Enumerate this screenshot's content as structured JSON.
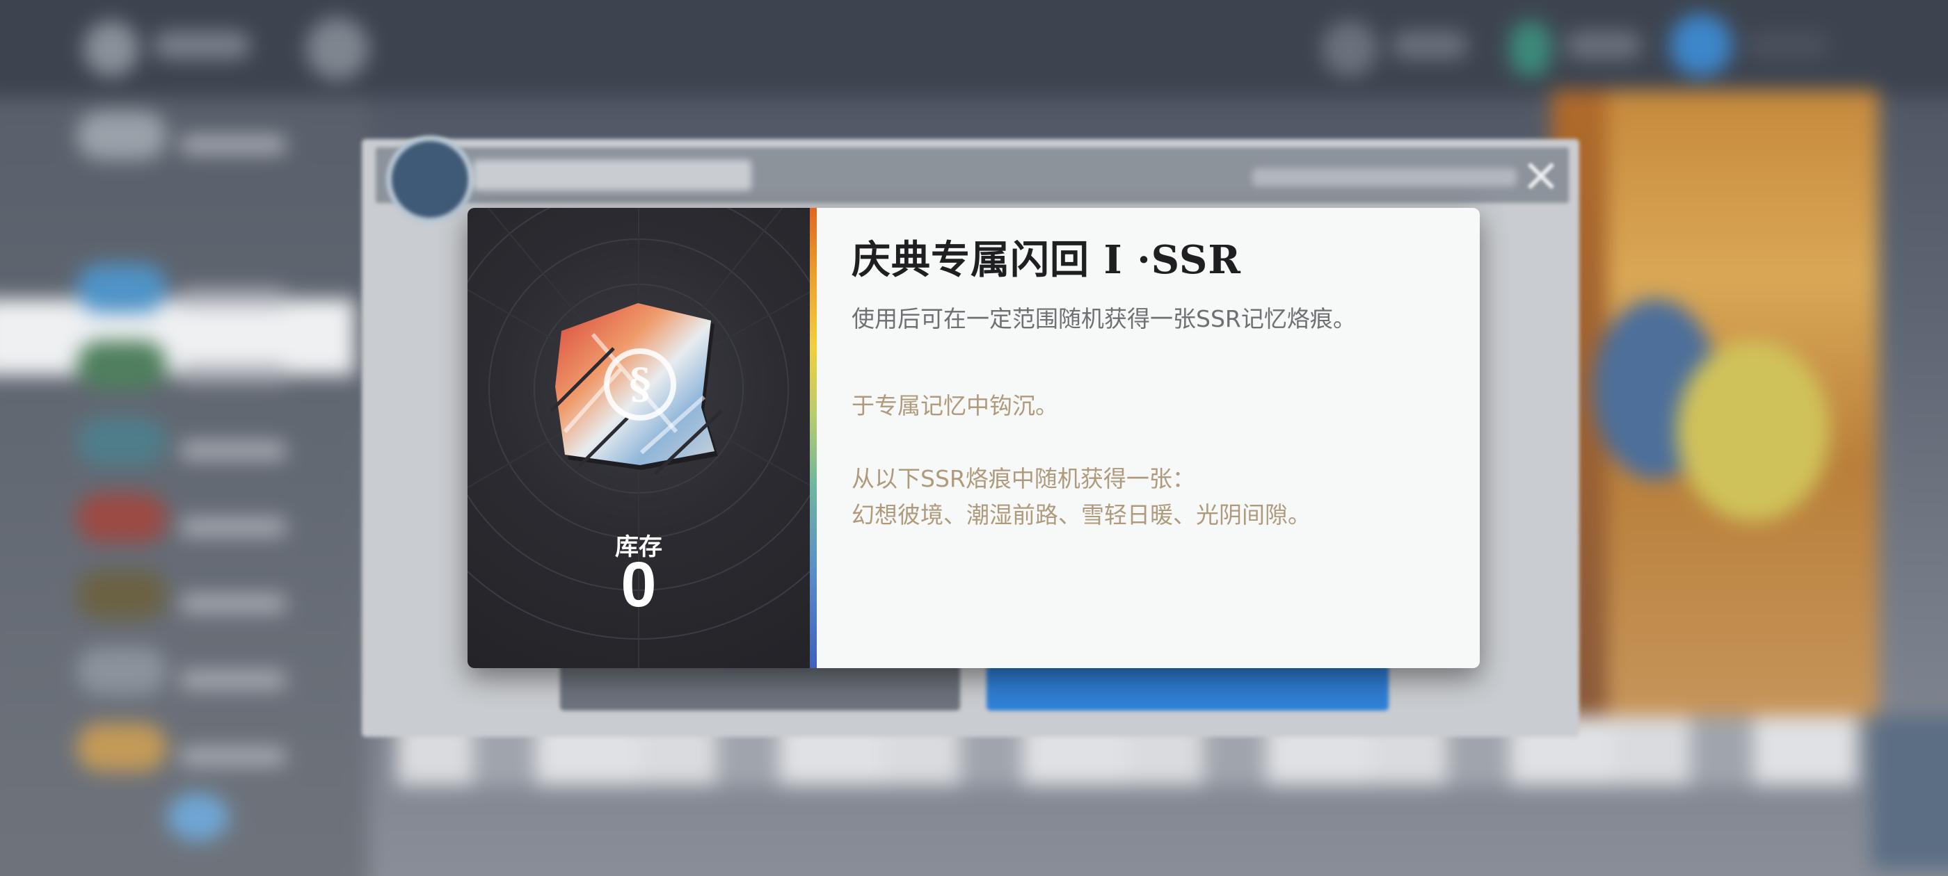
{
  "dialog": {
    "item_name": "庆典专属闪回 I ·SSR",
    "description": "使用后可在一定范围随机获得一张SSR记忆烙痕。",
    "flavor_text": "于专属记忆中钩沉。",
    "pool_intro": "从以下SSR烙痕中随机获得一张：",
    "pool_list": "幻想彼境、潮湿前路、雪轻日暖、光阴间隙。",
    "stock_label": "库存",
    "stock_value": "0",
    "icon": "ssr-memory-fragment-icon"
  },
  "colors": {
    "left_panel_bg": "#2b2b31",
    "right_panel_bg": "#f7f9f8",
    "title_text": "#1f1f22",
    "description_text": "#6f6f74",
    "flavor_text": "#b09a7c",
    "shop_confirm_button": "#2f7fd6"
  }
}
